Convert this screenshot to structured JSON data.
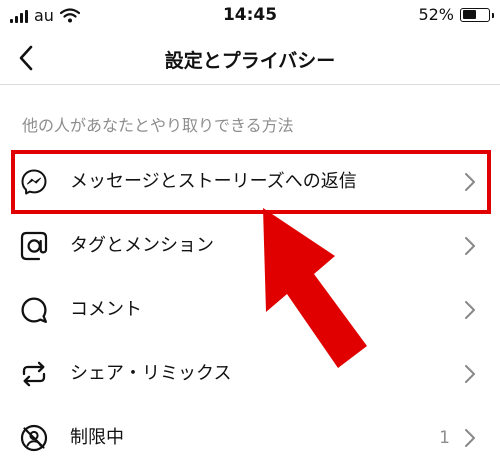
{
  "status_bar": {
    "carrier": "au",
    "time": "14:45",
    "battery_text": "52%",
    "battery_level": 0.52
  },
  "nav": {
    "title": "設定とプライバシー",
    "back_icon": "chevron-left-icon"
  },
  "section": {
    "header": "他の人があなたとやり取りできる方法"
  },
  "items": [
    {
      "label": "メッセージとストーリーズへの返信",
      "icon": "messenger-icon"
    },
    {
      "label": "タグとメンション",
      "icon": "at-sign-icon"
    },
    {
      "label": "コメント",
      "icon": "comment-bubble-icon"
    },
    {
      "label": "シェア・リミックス",
      "icon": "repost-icon"
    },
    {
      "label": "制限中",
      "icon": "restricted-icon",
      "count": "1"
    }
  ],
  "annotation": {
    "highlight_color": "#e00000"
  }
}
